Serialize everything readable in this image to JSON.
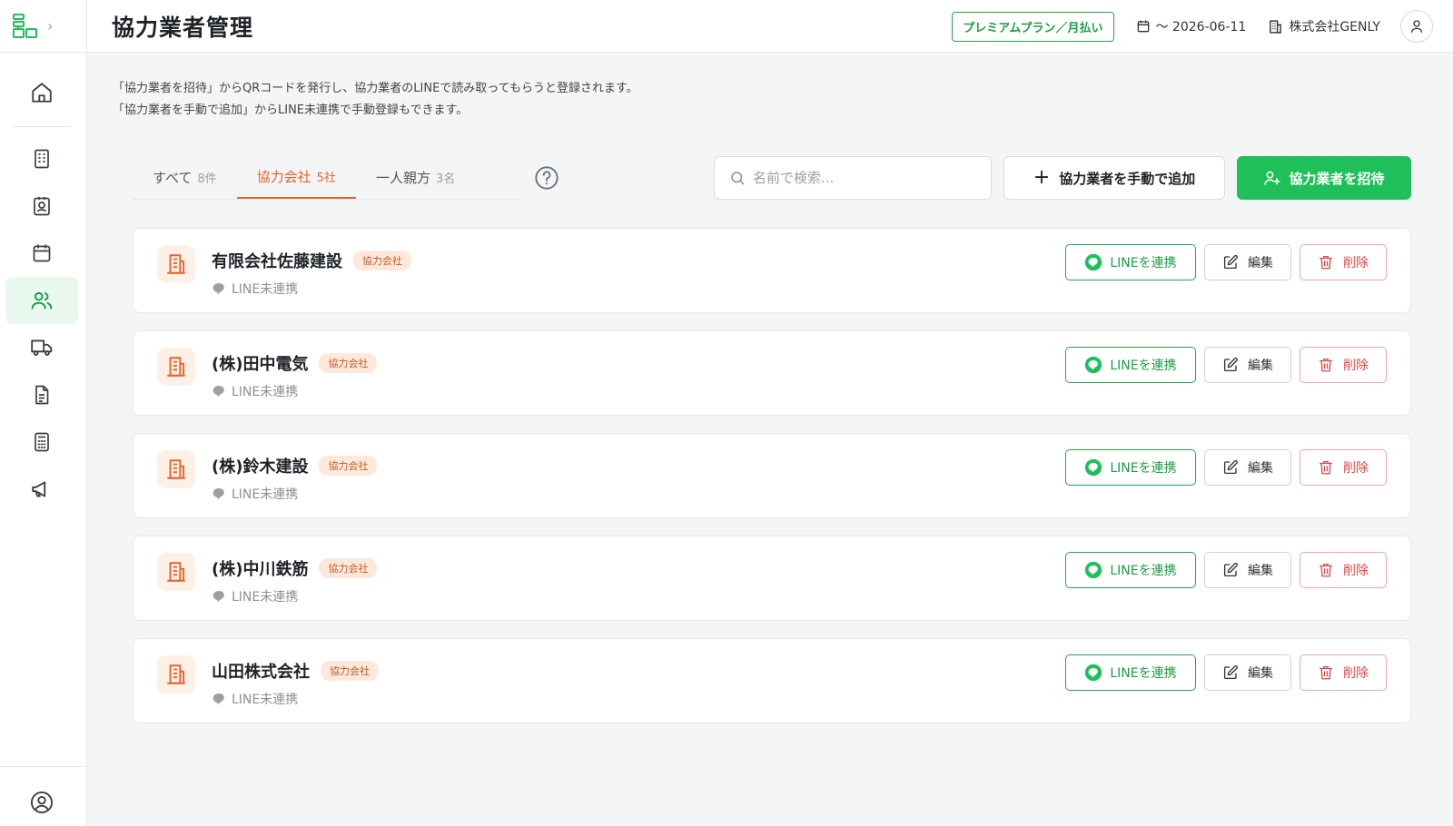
{
  "header": {
    "title": "協力業者管理",
    "plan": "プレミアムプラン／月払い",
    "date": "〜 2026-06-11",
    "company": "株式会社GENLY"
  },
  "description": {
    "line1": "「協力業者を招待」からQRコードを発行し、協力業者のLINEで読み取ってもらうと登録されます。",
    "line2": "「協力業者を手動で追加」からLINE未連携で手動登録もできます。"
  },
  "tabs": [
    {
      "label": "すべて",
      "count": "8件"
    },
    {
      "label": "協力会社",
      "count": "5社"
    },
    {
      "label": "一人親方",
      "count": "3名"
    }
  ],
  "search": {
    "placeholder": "名前で検索..."
  },
  "buttons": {
    "manual_add": "協力業者を手動で追加",
    "invite": "協力業者を招待",
    "line_link": "LINEを連携",
    "edit": "編集",
    "delete": "削除"
  },
  "contractors": [
    {
      "name": "有限会社佐藤建設",
      "type": "協力会社",
      "line_status": "LINE未連携"
    },
    {
      "name": "(株)田中電気",
      "type": "協力会社",
      "line_status": "LINE未連携"
    },
    {
      "name": "(株)鈴木建設",
      "type": "協力会社",
      "line_status": "LINE未連携"
    },
    {
      "name": "(株)中川鉄筋",
      "type": "協力会社",
      "line_status": "LINE未連携"
    },
    {
      "name": "山田株式会社",
      "type": "協力会社",
      "line_status": "LINE未連携"
    }
  ],
  "colors": {
    "brand_green": "#1fc05a",
    "accent_orange": "#e8642c",
    "danger_red": "#e04848"
  },
  "sidebar": {
    "icons": [
      "home-icon",
      "building-icon",
      "contact-card-icon",
      "calendar-icon",
      "users-icon",
      "truck-icon",
      "document-icon",
      "calculator-icon",
      "megaphone-icon",
      "account-icon"
    ],
    "active": "users-icon"
  }
}
